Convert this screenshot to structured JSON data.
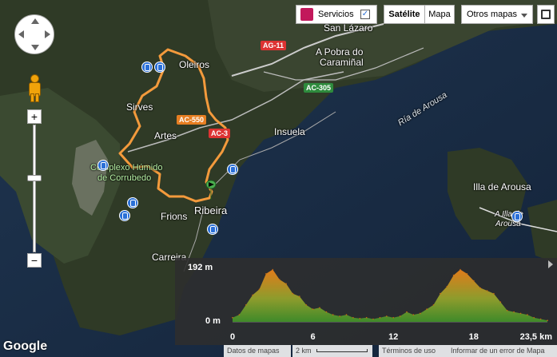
{
  "map": {
    "places": [
      {
        "id": "san-lazaro",
        "text": "San Lázaro"
      },
      {
        "id": "a-pobra",
        "text": "A Pobra do"
      },
      {
        "id": "caraminal",
        "text": "Caramiñal"
      },
      {
        "id": "oleiros",
        "text": "Oleiros"
      },
      {
        "id": "sirves",
        "text": "Sirves"
      },
      {
        "id": "artes",
        "text": "Artes"
      },
      {
        "id": "insuela",
        "text": "Insuela"
      },
      {
        "id": "ria-arousa",
        "text": "Ría de Arousa"
      },
      {
        "id": "complexo1",
        "text": "Complexo Húmido"
      },
      {
        "id": "complexo2",
        "text": "de Corrubedo"
      },
      {
        "id": "ribeira",
        "text": "Ribeira"
      },
      {
        "id": "frions",
        "text": "Frions"
      },
      {
        "id": "illa-arousa",
        "text": "Illa de Arousa"
      },
      {
        "id": "a-illa1",
        "text": "A Illa de"
      },
      {
        "id": "a-illa2",
        "text": "Arousa"
      },
      {
        "id": "carreira",
        "text": "Carreira"
      }
    ],
    "road_shields": [
      {
        "id": "ag11",
        "text": "AG-11",
        "color": "red"
      },
      {
        "id": "ac305",
        "text": "AC-305",
        "color": "green"
      },
      {
        "id": "ac550",
        "text": "AC-550",
        "color": "orange"
      },
      {
        "id": "ac-partial",
        "text": "AC-3",
        "color": "red"
      }
    ],
    "route_color": "#f39a3c"
  },
  "controls": {
    "servicios_label": "Servicios",
    "servicios_checked": true,
    "satelite_label": "Satélite",
    "mapa_label": "Mapa",
    "otros_label": "Otros mapas",
    "zoom_in": "+",
    "zoom_out": "−",
    "google_logo": "Google"
  },
  "profile": {
    "y_max_label": "192 m",
    "y_min_label": "0 m"
  },
  "chart_data": {
    "type": "area",
    "title": "",
    "xlabel": "",
    "ylabel": "",
    "x_unit": "km",
    "y_unit": "m",
    "xlim": [
      0,
      23.5
    ],
    "ylim": [
      0,
      192
    ],
    "x_tick_labels": [
      "0",
      "6",
      "12",
      "18",
      "23,5 km"
    ],
    "x_ticks": [
      0,
      6,
      12,
      18,
      23.5
    ],
    "x": [
      0,
      0.5,
      1,
      1.5,
      2,
      2.5,
      3,
      3.5,
      4,
      4.5,
      5,
      5.5,
      6,
      6.5,
      7,
      7.5,
      8,
      8.5,
      9,
      9.5,
      10,
      10.5,
      11,
      11.5,
      12,
      12.5,
      13,
      13.5,
      14,
      14.5,
      15,
      15.5,
      16,
      16.5,
      17,
      17.5,
      18,
      18.5,
      19,
      19.5,
      20,
      20.5,
      21,
      21.5,
      22,
      22.5,
      23,
      23.5
    ],
    "y": [
      15,
      25,
      60,
      95,
      115,
      170,
      185,
      150,
      135,
      100,
      90,
      60,
      45,
      50,
      35,
      25,
      20,
      25,
      15,
      12,
      15,
      10,
      15,
      20,
      15,
      20,
      35,
      25,
      30,
      45,
      60,
      100,
      125,
      165,
      185,
      170,
      145,
      120,
      110,
      100,
      70,
      40,
      35,
      30,
      25,
      15,
      10,
      5
    ]
  },
  "footer": {
    "datos": "Datos de mapas",
    "scale": "2 km",
    "terminos": "Términos de uso",
    "informar": "Informar de un error de Mapa"
  }
}
